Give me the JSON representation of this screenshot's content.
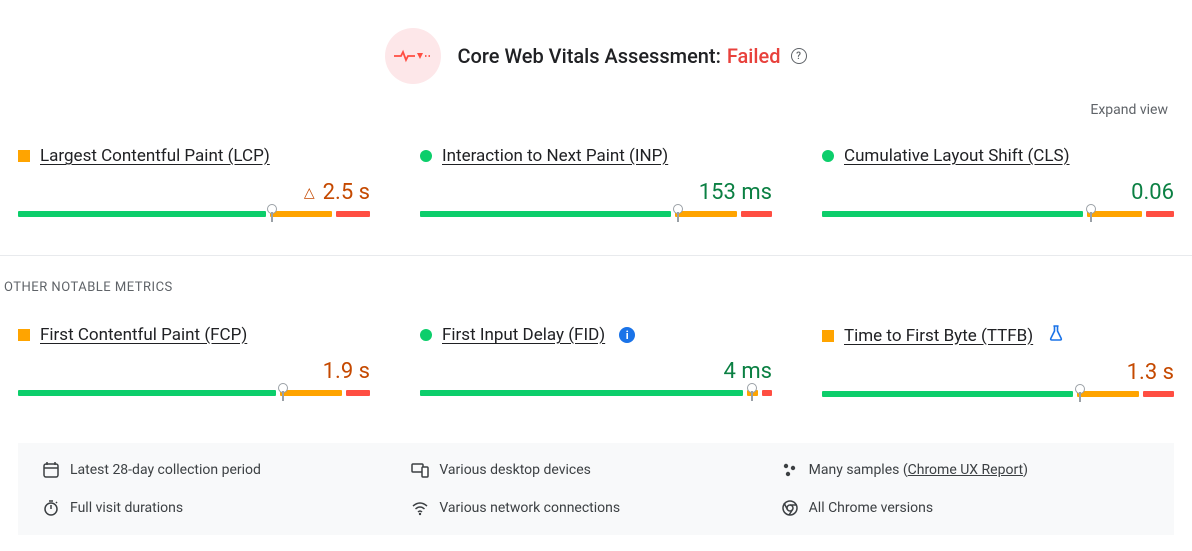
{
  "header": {
    "title_prefix": "Core Web Vitals Assessment: ",
    "status": "Failed"
  },
  "expand_view": "Expand view",
  "metrics": {
    "lcp": {
      "label": "Largest Contentful Paint (LCP)",
      "value": "2.5 s",
      "green": 72,
      "orange": 18,
      "red": 10,
      "marker": 72
    },
    "inp": {
      "label": "Interaction to Next Paint (INP)",
      "value": "153 ms",
      "green": 73,
      "orange": 18,
      "red": 9,
      "marker": 73
    },
    "cls": {
      "label": "Cumulative Layout Shift (CLS)",
      "value": "0.06",
      "green": 76,
      "orange": 16,
      "red": 8,
      "marker": 76
    },
    "fcp": {
      "label": "First Contentful Paint (FCP)",
      "value": "1.9 s",
      "green": 75,
      "orange": 18,
      "red": 7,
      "marker": 75
    },
    "fid": {
      "label": "First Input Delay (FID)",
      "value": "4 ms",
      "green": 94,
      "orange": 3,
      "red": 3,
      "marker": 94
    },
    "ttfb": {
      "label": "Time to First Byte (TTFB)",
      "value": "1.3 s",
      "green": 73,
      "orange": 18,
      "red": 9,
      "marker": 73
    }
  },
  "other_section": "OTHER NOTABLE METRICS",
  "footer": {
    "period": "Latest 28-day collection period",
    "devices": "Various desktop devices",
    "samples_prefix": "Many samples (",
    "samples_link": "Chrome UX Report",
    "samples_suffix": ")",
    "durations": "Full visit durations",
    "network": "Various network connections",
    "chrome": "All Chrome versions"
  }
}
